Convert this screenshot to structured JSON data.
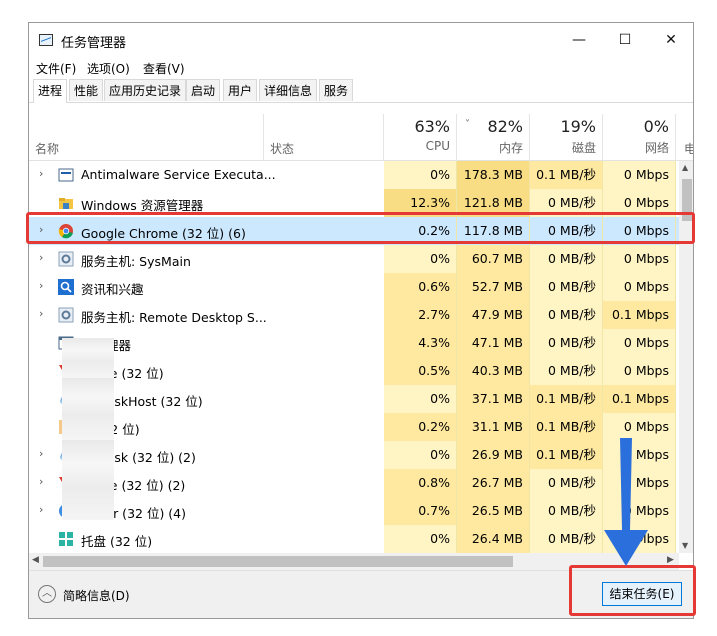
{
  "window": {
    "title": "任务管理器",
    "minimize": "—",
    "maximize": "☐",
    "close": "✕"
  },
  "menu": [
    "文件(F)",
    "选项(O)",
    "查看(V)"
  ],
  "tabs": [
    "进程",
    "性能",
    "应用历史记录",
    "启动",
    "用户",
    "详细信息",
    "服务"
  ],
  "columns": {
    "name": "名称",
    "status": "状态",
    "cpu": {
      "pct": "63%",
      "label": "CPU"
    },
    "mem": {
      "pct": "82%",
      "label": "内存"
    },
    "disk": {
      "pct": "19%",
      "label": "磁盘"
    },
    "net": {
      "pct": "0%",
      "label": "网络"
    },
    "power": "电"
  },
  "rows": [
    {
      "name": "Antimalware Service Executa...",
      "cpu": "0%",
      "mem": "178.3 MB",
      "disk": "0.1 MB/秒",
      "net": "0 Mbps",
      "icon": "service-icon",
      "expand": "›"
    },
    {
      "name": "Windows 资源管理器",
      "cpu": "12.3%",
      "mem": "121.8 MB",
      "disk": "0 MB/秒",
      "net": "0 Mbps",
      "icon": "folder-icon",
      "expand": ""
    },
    {
      "name": "Google Chrome (32 位) (6)",
      "cpu": "0.2%",
      "mem": "117.8 MB",
      "disk": "0 MB/秒",
      "net": "0 Mbps",
      "icon": "chrome-icon",
      "expand": "›"
    },
    {
      "name": "服务主机: SysMain",
      "cpu": "0%",
      "mem": "60.7 MB",
      "disk": "0 MB/秒",
      "net": "0 Mbps",
      "icon": "gear-icon",
      "expand": "›"
    },
    {
      "name": "资讯和兴趣",
      "cpu": "0.6%",
      "mem": "52.7 MB",
      "disk": "0 MB/秒",
      "net": "0 Mbps",
      "icon": "search-icon",
      "expand": "›"
    },
    {
      "name": "服务主机: Remote Desktop S...",
      "cpu": "2.7%",
      "mem": "47.9 MB",
      "disk": "0 MB/秒",
      "net": "0.1 Mbps",
      "icon": "gear-icon",
      "expand": "›"
    },
    {
      "name": "口管理器",
      "cpu": "4.3%",
      "mem": "47.1 MB",
      "disk": "0 MB/秒",
      "net": "0 Mbps",
      "icon": "window-icon",
      "expand": ""
    },
    {
      "name": "Office (32 位)",
      "cpu": "0.5%",
      "mem": "40.3 MB",
      "disk": "0 MB/秒",
      "net": "0 Mbps",
      "icon": "office-icon",
      "expand": ""
    },
    {
      "name": "NetdiskHost (32 位)",
      "cpu": "0%",
      "mem": "37.1 MB",
      "disk": "0.1 MB/秒",
      "net": "0.1 Mbps",
      "icon": "cloud-icon",
      "expand": ""
    },
    {
      "name": "身 (32 位)",
      "cpu": "0.2%",
      "mem": "31.1 MB",
      "disk": "0.1 MB/秒",
      "net": "0 Mbps",
      "icon": "app-icon",
      "expand": ""
    },
    {
      "name": "Netdisk (32 位) (2)",
      "cpu": "0%",
      "mem": "26.9 MB",
      "disk": "0.1 MB/秒",
      "net": "0 Mbps",
      "icon": "cloud-icon",
      "expand": "›"
    },
    {
      "name": "Office (32 位) (2)",
      "cpu": "0.8%",
      "mem": "26.7 MB",
      "disk": "0 MB/秒",
      "net": "0 Mbps",
      "icon": "office-icon",
      "expand": "›"
    },
    {
      "name": "owser (32 位) (4)",
      "cpu": "0.7%",
      "mem": "26.5 MB",
      "disk": "0 MB/秒",
      "net": "0 Mbps",
      "icon": "browser-icon",
      "expand": "›"
    },
    {
      "name": "托盘 (32 位)",
      "cpu": "0%",
      "mem": "26.4 MB",
      "disk": "0 MB/秒",
      "net": "0 Mbps",
      "icon": "tray-icon",
      "expand": ""
    }
  ],
  "footer": {
    "fewer_details": "简略信息(D)",
    "end_task": "结束任务(E)"
  },
  "colors": {
    "heat_light": "#fff4c4",
    "heat_mid": "#ffe9a0",
    "heat_strong": "#f9dd84",
    "selected": "#cce8ff",
    "highlight": "#e53935",
    "arrow": "#2a6fdb"
  }
}
